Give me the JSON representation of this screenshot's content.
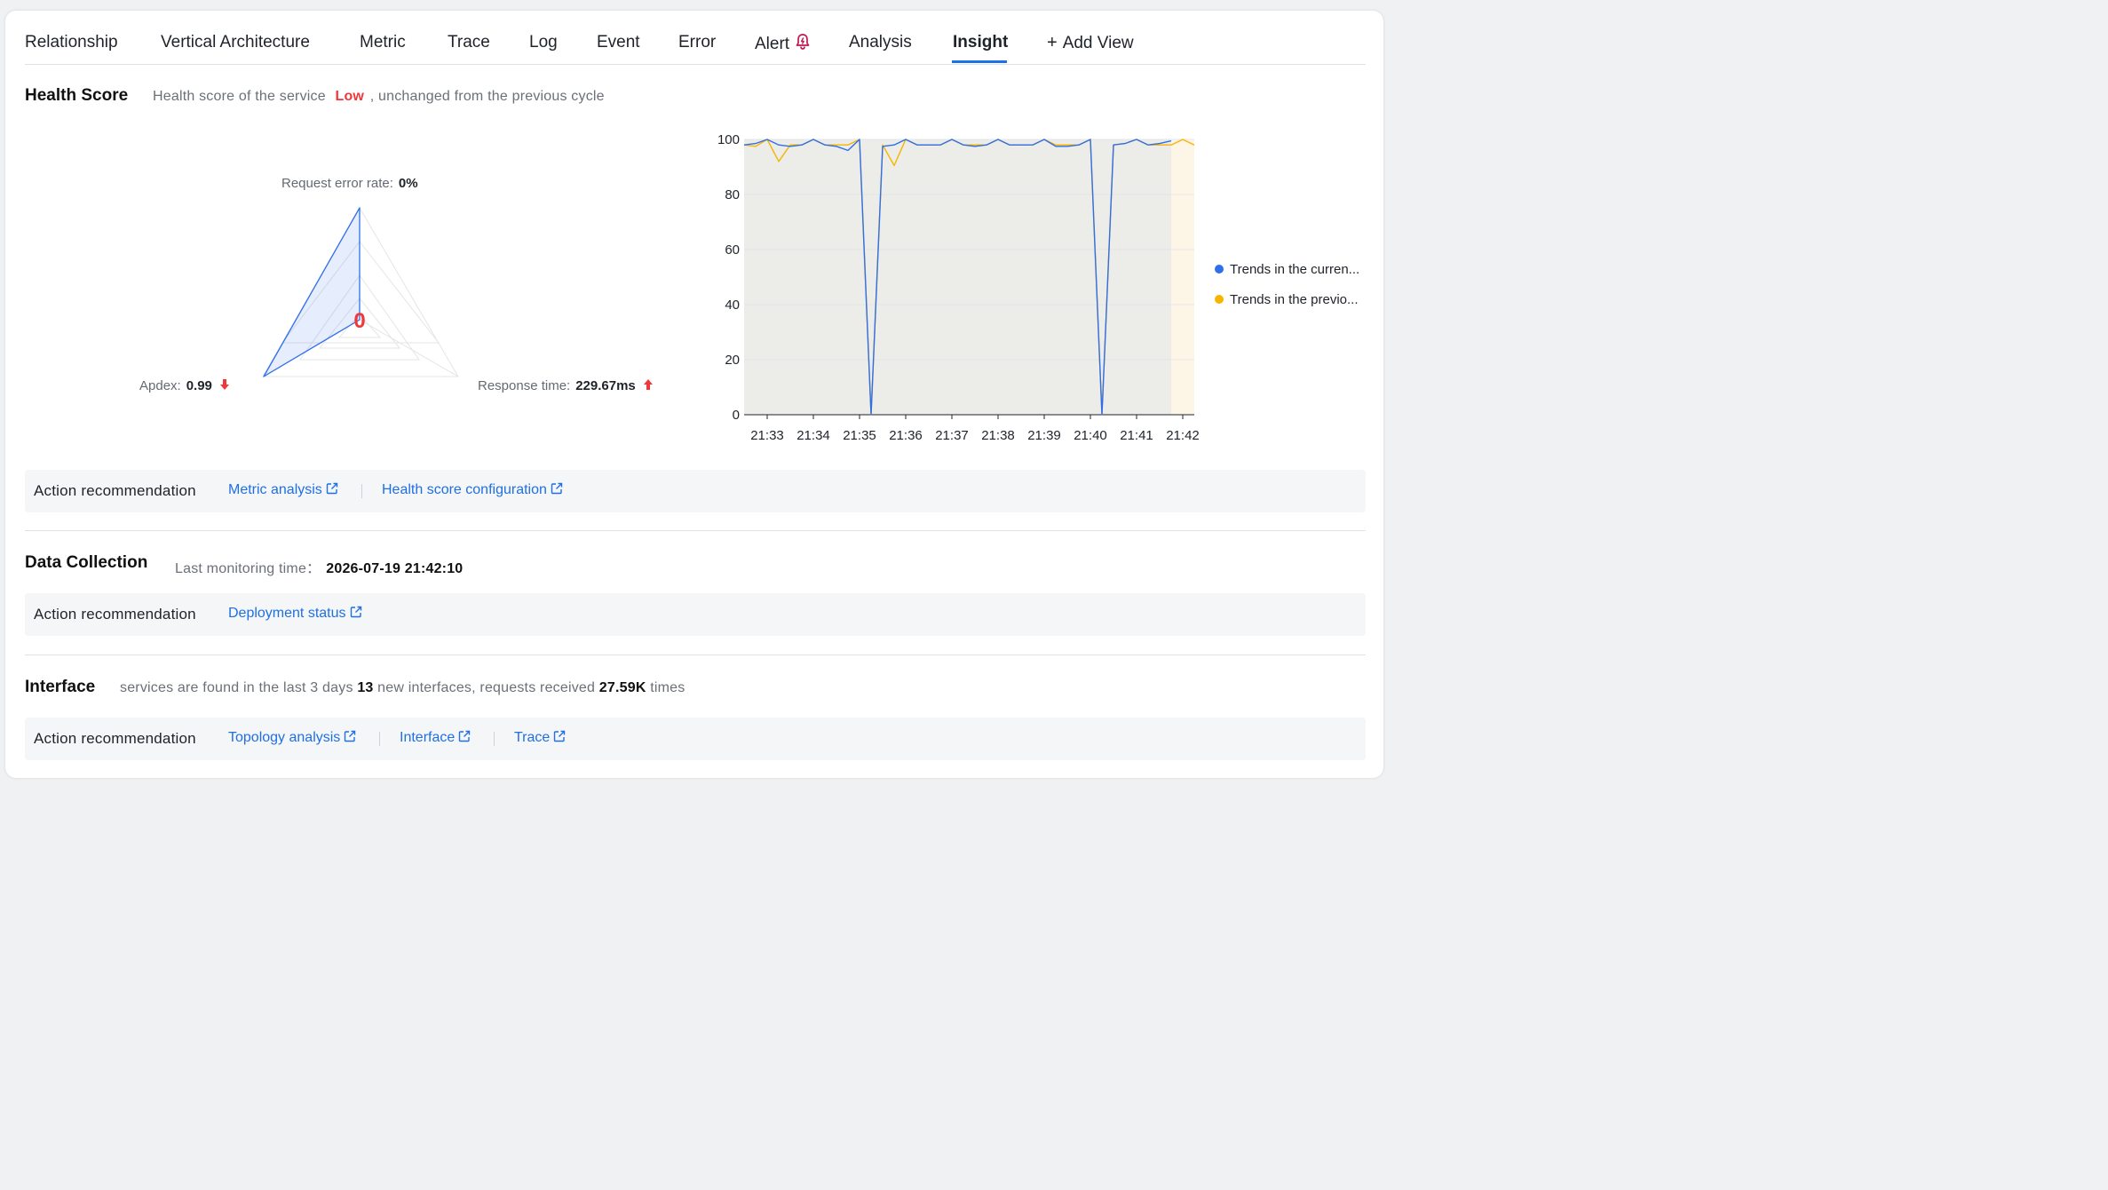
{
  "tabs": [
    {
      "label": "Relationship"
    },
    {
      "label": "Vertical Architecture"
    },
    {
      "label": "Metric"
    },
    {
      "label": "Trace"
    },
    {
      "label": "Log"
    },
    {
      "label": "Event"
    },
    {
      "label": "Error"
    },
    {
      "label": "Alert"
    },
    {
      "label": "Analysis"
    },
    {
      "label": "Insight"
    },
    {
      "label": "Add View"
    }
  ],
  "active_tab": "Insight",
  "health": {
    "title": "Health Score",
    "sub_prefix": "Health score of the service",
    "level": "Low",
    "sub_suffix": ", unchanged from the previous cycle",
    "center_score": "0",
    "metrics": {
      "error_rate_label": "Request error rate:",
      "error_rate_value": "0%",
      "apdex_label": "Apdex:",
      "apdex_value": "0.99",
      "response_label": "Response time:",
      "response_value": "229.67ms"
    },
    "action_label": "Action recommendation",
    "links": [
      "Metric analysis",
      "Health score configuration"
    ]
  },
  "chart_data": {
    "type": "line",
    "title": "",
    "xlabel": "",
    "ylabel": "",
    "ylim": [
      0,
      100
    ],
    "yticks": [
      0,
      20,
      40,
      60,
      80,
      100
    ],
    "x_ticks": [
      "21:33",
      "21:34",
      "21:35",
      "21:36",
      "21:37",
      "21:38",
      "21:39",
      "21:40",
      "21:41",
      "21:42"
    ],
    "x_range": [
      "21:32.5",
      "21:42.25"
    ],
    "grid": "horizontal",
    "legend_position": "right",
    "series": [
      {
        "name": "Trends in the curren...",
        "color": "#2f6fec",
        "x": [
          32.5,
          32.75,
          33.0,
          33.25,
          33.5,
          33.75,
          34.0,
          34.25,
          34.5,
          34.75,
          35.0,
          35.25,
          35.5,
          35.75,
          36.0,
          36.25,
          36.5,
          36.75,
          37.0,
          37.25,
          37.5,
          37.75,
          38.0,
          38.25,
          38.5,
          38.75,
          39.0,
          39.25,
          39.5,
          39.75,
          40.0,
          40.25,
          40.5,
          40.75,
          41.0,
          41.25,
          41.5,
          41.75
        ],
        "values": [
          98,
          98.5,
          100,
          98,
          97.5,
          98,
          100,
          98,
          97.5,
          96,
          100,
          0,
          97.5,
          98,
          100,
          98,
          98,
          98,
          100,
          98,
          97.5,
          98,
          100,
          98,
          98,
          98,
          100,
          97.5,
          97.5,
          98,
          100,
          0,
          98,
          98.5,
          100,
          98,
          98.5,
          99.5
        ]
      },
      {
        "name": "Trends in the previo...",
        "color": "#f7b500",
        "x": [
          32.5,
          32.75,
          33.0,
          33.25,
          33.5,
          33.75,
          34.0,
          34.25,
          34.5,
          34.75,
          35.0,
          35.25,
          35.5,
          35.75,
          36.0,
          36.25,
          36.5,
          36.75,
          37.0,
          37.25,
          37.5,
          37.75,
          38.0,
          38.25,
          38.5,
          38.75,
          39.0,
          39.25,
          39.5,
          39.75,
          40.0,
          40.25,
          40.5,
          40.75,
          41.0,
          41.25,
          41.5,
          41.75,
          42.0,
          42.25
        ],
        "values": [
          98,
          97.5,
          100,
          92,
          98,
          98,
          100,
          98,
          98,
          98,
          100,
          0,
          98,
          90.5,
          100,
          98,
          98,
          98,
          100,
          98,
          98,
          98,
          100,
          98,
          98,
          98,
          100,
          98,
          98,
          98,
          100,
          0,
          98,
          98.5,
          100,
          98,
          98,
          98,
          100,
          98
        ]
      }
    ],
    "shaded_regions": [
      {
        "from": 32.5,
        "to": 41.75,
        "color": "#ecece8"
      },
      {
        "from": 41.75,
        "to": 42.25,
        "color": "#fdf6e6"
      }
    ]
  },
  "data_collection": {
    "title": "Data Collection",
    "last_label": "Last monitoring time：",
    "last_value": "2026-07-19 21:42:10",
    "action_label": "Action recommendation",
    "links": [
      "Deployment status"
    ]
  },
  "interface": {
    "title": "Interface",
    "sub_a": "services are found in the last 3 days",
    "count": "13",
    "sub_b": "new interfaces, requests received",
    "requests": "27.59K",
    "sub_c": "times",
    "action_label": "Action recommendation",
    "links": [
      "Topology analysis",
      "Interface",
      "Trace"
    ]
  }
}
